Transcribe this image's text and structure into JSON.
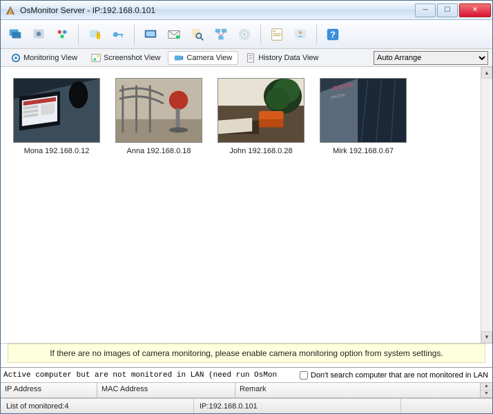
{
  "window": {
    "title": "OsMonitor Server -  IP:192.168.0.101"
  },
  "tabs": {
    "monitoring": "Monitoring View",
    "screenshot": "Screenshot View",
    "camera": "Camera View",
    "history": "History Data View"
  },
  "arrange": {
    "selected": "Auto Arrange",
    "options": [
      "Auto Arrange"
    ]
  },
  "cameras": [
    {
      "label": "Mona 192.168.0.12"
    },
    {
      "label": "Anna 192.168.0.18"
    },
    {
      "label": "John 192.168.0.28"
    },
    {
      "label": "Mirk 192.168.0.67"
    }
  ],
  "info_message": "If there are no images of camera monitoring, please enable camera monitoring option from system settings.",
  "bottom": {
    "filter_text": "Active computer but are not monitored in LAN (need run OsMon",
    "checkbox_label": "Don't search computer that are not monitored in LAN",
    "columns": {
      "ip": "IP Address",
      "mac": "MAC Address",
      "remark": "Remark"
    }
  },
  "status": {
    "left": "List of monitored:4",
    "center": "IP:192.168.0.101"
  }
}
